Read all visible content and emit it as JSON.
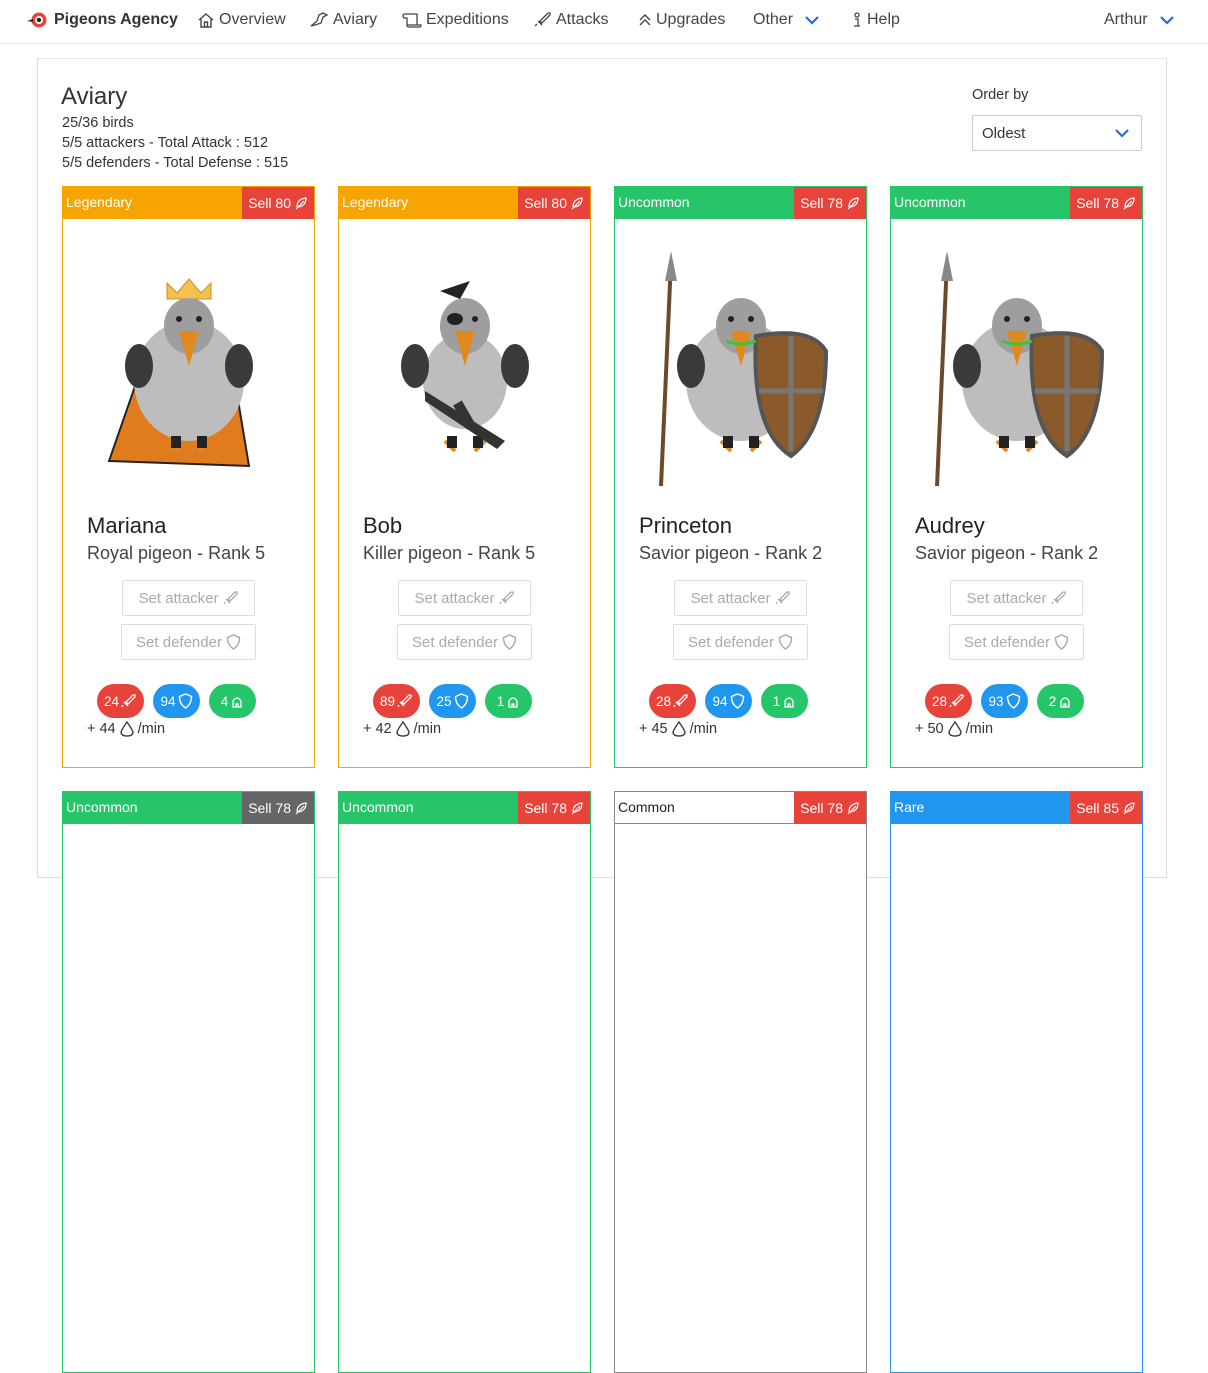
{
  "nav": {
    "brand": "Pigeons Agency",
    "overview": "Overview",
    "aviary": "Aviary",
    "expeditions": "Expeditions",
    "attacks": "Attacks",
    "upgrades": "Upgrades",
    "other": "Other",
    "help": "Help",
    "user": "Arthur"
  },
  "page": {
    "title": "Aviary",
    "birds_count": "25/36 birds",
    "attackers": "5/5 attackers - Total Attack : 512",
    "defenders": "5/5 defenders - Total Defense : 515",
    "order_label": "Order by",
    "order_value": "Oldest"
  },
  "colors": {
    "legendary": "#f6a400",
    "uncommon": "#27c56a",
    "common": "#ffffff",
    "rare": "#2196ee",
    "sell": "#e8433a",
    "sell_disabled": "#666666",
    "attack": "#e8433a",
    "defense": "#2196ee",
    "feed": "#27c56a"
  },
  "cards": [
    {
      "rarity": "Legendary",
      "sell": "Sell 80",
      "name": "Mariana",
      "type": "Royal pigeon - Rank 5",
      "set_attacker": "Set attacker",
      "set_defender": "Set defender",
      "attack": "24",
      "defense": "94",
      "feed": "4",
      "rate": "+ 44",
      "rate_unit": "/min",
      "bird": "royal"
    },
    {
      "rarity": "Legendary",
      "sell": "Sell 80",
      "name": "Bob",
      "type": "Killer pigeon - Rank 5",
      "set_attacker": "Set attacker",
      "set_defender": "Set defender",
      "attack": "89",
      "defense": "25",
      "feed": "1",
      "rate": "+ 42",
      "rate_unit": "/min",
      "bird": "killer"
    },
    {
      "rarity": "Uncommon",
      "sell": "Sell 78",
      "name": "Princeton",
      "type": "Savior pigeon - Rank 2",
      "set_attacker": "Set attacker",
      "set_defender": "Set defender",
      "attack": "28",
      "defense": "94",
      "feed": "1",
      "rate": "+ 45",
      "rate_unit": "/min",
      "bird": "savior"
    },
    {
      "rarity": "Uncommon",
      "sell": "Sell 78",
      "name": "Audrey",
      "type": "Savior pigeon - Rank 2",
      "set_attacker": "Set attacker",
      "set_defender": "Set defender",
      "attack": "28",
      "defense": "93",
      "feed": "2",
      "rate": "+ 50",
      "rate_unit": "/min",
      "bird": "savior"
    },
    {
      "rarity": "Uncommon",
      "sell": "Sell 78"
    },
    {
      "rarity": "Uncommon",
      "sell": "Sell 78"
    },
    {
      "rarity": "Common",
      "sell": "Sell 78"
    },
    {
      "rarity": "Rare",
      "sell": "Sell 85"
    }
  ]
}
